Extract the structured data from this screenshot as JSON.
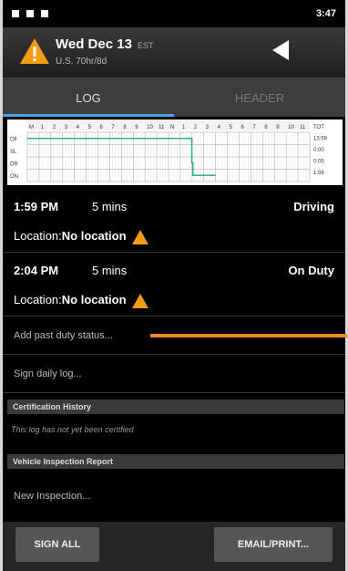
{
  "status_bar": {
    "time": "3:47",
    "icons": [
      "notification-icon",
      "sim-icon",
      "battery-icon"
    ]
  },
  "header": {
    "date": "Wed Dec 13",
    "timezone": "EST",
    "cycle": "U.S. 70hr/8d",
    "warning_icon": "warning-icon",
    "back_icon": "back-arrow-icon"
  },
  "tabs": [
    {
      "label": "LOG",
      "active": true
    },
    {
      "label": "HEADER",
      "active": false
    }
  ],
  "chart_data": {
    "type": "line",
    "x": [
      "M",
      "1",
      "2",
      "3",
      "4",
      "5",
      "6",
      "7",
      "8",
      "9",
      "10",
      "11",
      "N",
      "1",
      "2",
      "3",
      "4",
      "5",
      "6",
      "7",
      "8",
      "9",
      "10",
      "11"
    ],
    "y_categories": [
      "OF",
      "SL",
      "DR",
      "ON"
    ],
    "right_labels": [
      "TOT",
      "13:59",
      "0:00",
      "0:05",
      "1:56"
    ],
    "series": [
      {
        "points": [
          [
            0,
            "OF"
          ],
          [
            13.98,
            "OF"
          ],
          [
            13.98,
            "DR"
          ],
          [
            14.07,
            "DR"
          ],
          [
            14.07,
            "ON"
          ],
          [
            16,
            "ON"
          ]
        ]
      }
    ]
  },
  "entries": [
    {
      "time": "1:59 PM",
      "duration": "5 mins",
      "status": "Driving",
      "location_label": "Location:",
      "location": "No location"
    },
    {
      "time": "2:04 PM",
      "duration": "5 mins",
      "status": "On Duty",
      "location_label": "Location:",
      "location": "No location"
    }
  ],
  "actions": {
    "add_past": "Add past duty status...",
    "sign_log": "Sign daily log...",
    "certification_title": "Certification History",
    "certification_note": "This log has not yet been certified",
    "inspection_title": "Vehicle Inspection Report",
    "new_inspection": "New Inspection..."
  },
  "footer": {
    "sign_all": "SIGN ALL",
    "email_print": "EMAIL/PRINT..."
  },
  "colors": {
    "accent": "#4aa3df",
    "warning": "#f39c12",
    "highlight": "#f08a24",
    "graph_line": "#2fb57a"
  }
}
